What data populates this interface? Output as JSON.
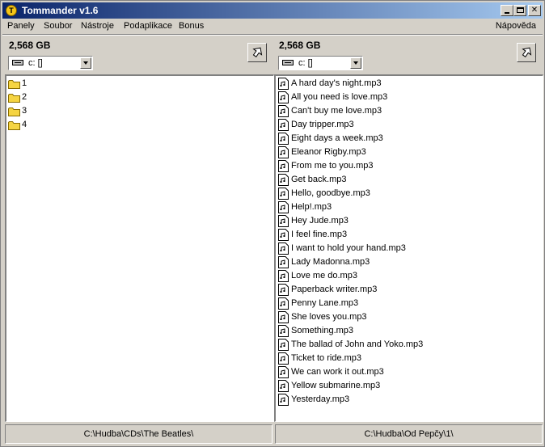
{
  "window": {
    "title": "Tommander v1.6",
    "app_icon_letter": "T"
  },
  "menu": {
    "items": [
      "Panely",
      "Soubor",
      "Nástroje",
      "Podaplikace",
      "Bonus"
    ],
    "help": "Nápověda"
  },
  "left_panel": {
    "free_space": "2,568 GB",
    "drive": "c: []",
    "items": [
      "1",
      "2",
      "3",
      "4"
    ],
    "path": "C:\\Hudba\\CDs\\The Beatles\\"
  },
  "right_panel": {
    "free_space": "2,568 GB",
    "drive": "c: []",
    "items": [
      "A hard day's night.mp3",
      "All you need is love.mp3",
      "Can't buy me love.mp3",
      "Day tripper.mp3",
      "Eight days a week.mp3",
      "Eleanor Rigby.mp3",
      "From me to you.mp3",
      "Get back.mp3",
      "Hello, goodbye.mp3",
      "Help!.mp3",
      "Hey Jude.mp3",
      "I feel fine.mp3",
      "I want to hold your hand.mp3",
      "Lady Madonna.mp3",
      "Love me do.mp3",
      "Paperback writer.mp3",
      "Penny Lane.mp3",
      "She loves you.mp3",
      "Something.mp3",
      "The ballad of John and Yoko.mp3",
      "Ticket to ride.mp3",
      "We can work it out.mp3",
      "Yellow submarine.mp3",
      "Yesterday.mp3"
    ],
    "path": "C:\\Hudba\\Od Pepčy\\1\\"
  },
  "icons": {
    "folder": "folder-icon",
    "file": "audio-file-icon",
    "drive": "drive-icon",
    "up": "up-directory-icon"
  },
  "colors": {
    "title_gradient_start": "#0a246a",
    "title_gradient_end": "#a6caf0",
    "folder": "#f5d442",
    "face": "#d4d0c8"
  }
}
